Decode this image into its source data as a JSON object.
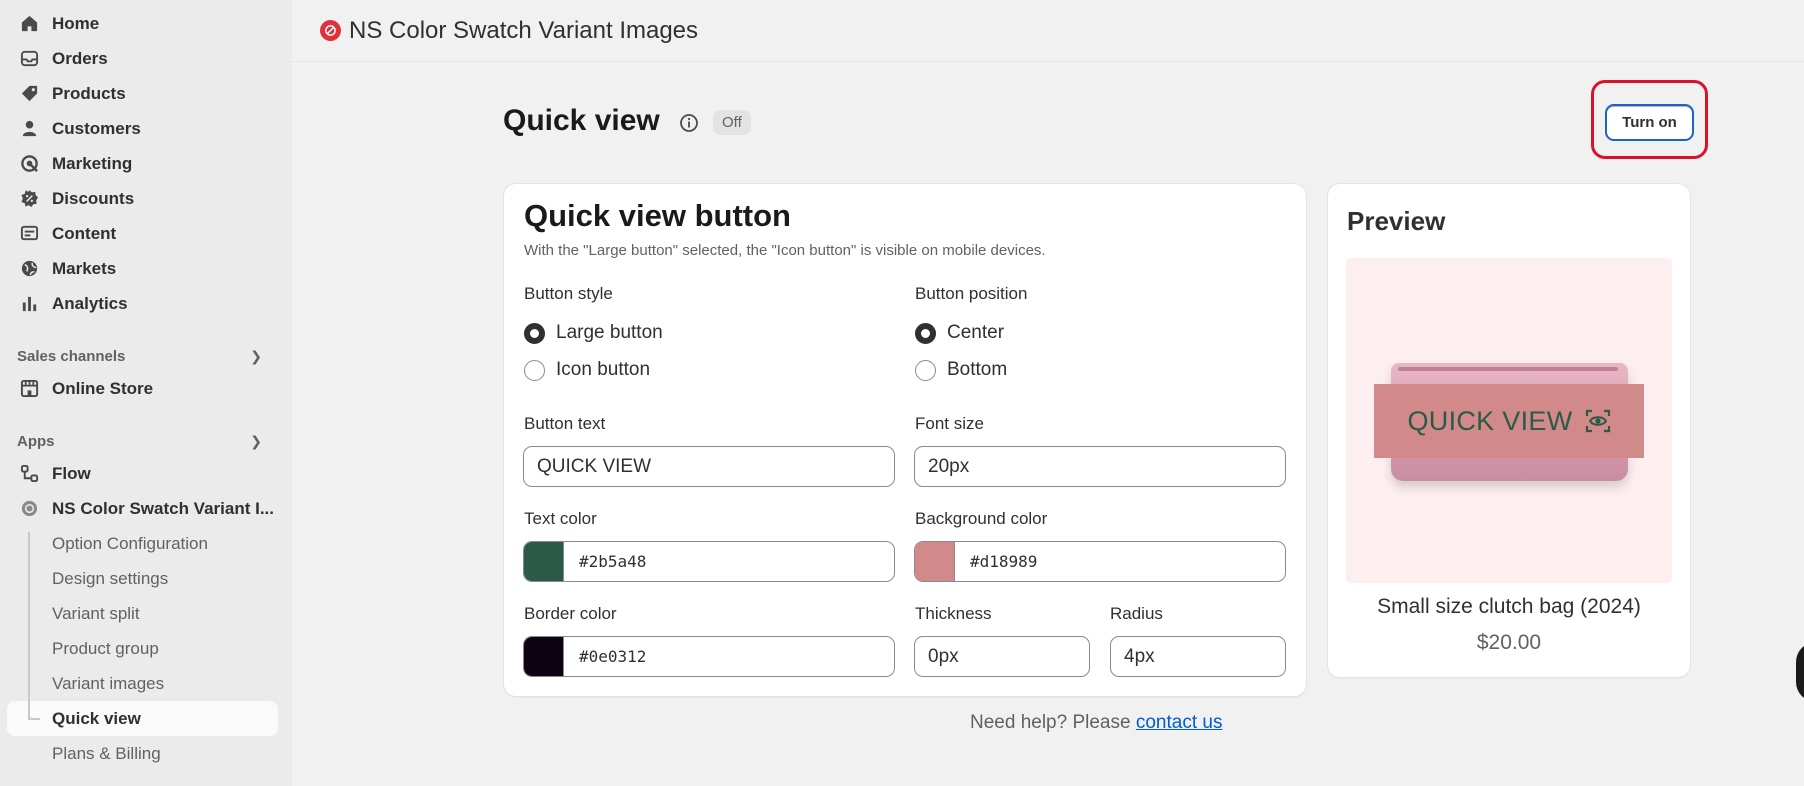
{
  "sidebar": {
    "main": [
      {
        "label": "Home",
        "icon": "home-icon"
      },
      {
        "label": "Orders",
        "icon": "inbox-icon"
      },
      {
        "label": "Products",
        "icon": "tag-icon"
      },
      {
        "label": "Customers",
        "icon": "person-icon"
      },
      {
        "label": "Marketing",
        "icon": "target-icon"
      },
      {
        "label": "Discounts",
        "icon": "discount-icon"
      },
      {
        "label": "Content",
        "icon": "content-icon"
      },
      {
        "label": "Markets",
        "icon": "globe-icon"
      },
      {
        "label": "Analytics",
        "icon": "chart-bar-icon"
      }
    ],
    "sales_channels": {
      "heading": "Sales channels",
      "items": [
        {
          "label": "Online Store"
        }
      ]
    },
    "apps": {
      "heading": "Apps",
      "items": [
        {
          "label": "Flow"
        },
        {
          "label": "NS Color Swatch Variant I..."
        }
      ],
      "sub_items": [
        {
          "label": "Option Configuration"
        },
        {
          "label": "Design settings"
        },
        {
          "label": "Variant split"
        },
        {
          "label": "Product group"
        },
        {
          "label": "Variant images"
        },
        {
          "label": "Quick view",
          "active": true
        },
        {
          "label": "Plans & Billing"
        }
      ]
    }
  },
  "topbar": {
    "app_title": "NS Color Swatch Variant Images"
  },
  "page": {
    "title": "Quick view",
    "status_badge": "Off",
    "turn_on_label": "Turn on"
  },
  "settings": {
    "title": "Quick view button",
    "subtitle": "With the \"Large button\" selected, the \"Icon button\" is visible on mobile devices.",
    "button_style": {
      "label": "Button style",
      "options": [
        "Large button",
        "Icon button"
      ],
      "selected": "Large button"
    },
    "button_position": {
      "label": "Button position",
      "options": [
        "Center",
        "Bottom"
      ],
      "selected": "Center"
    },
    "button_text": {
      "label": "Button text",
      "value": "QUICK VIEW"
    },
    "font_size": {
      "label": "Font size",
      "value": "20px"
    },
    "text_color": {
      "label": "Text color",
      "value": "#2b5a48"
    },
    "background_color": {
      "label": "Background color",
      "value": "#d18989"
    },
    "border_color": {
      "label": "Border color",
      "value": "#0e0312"
    },
    "thickness": {
      "label": "Thickness",
      "value": "0px"
    },
    "radius": {
      "label": "Radius",
      "value": "4px"
    }
  },
  "preview": {
    "title": "Preview",
    "button_label": "QUICK VIEW",
    "product_name": "Small size clutch bag (2024)",
    "product_price": "$20.00"
  },
  "help": {
    "text": "Need help? Please ",
    "link": "contact us"
  },
  "colors": {
    "accent_blue": "#005bd3",
    "highlight_red": "#d9142a"
  }
}
